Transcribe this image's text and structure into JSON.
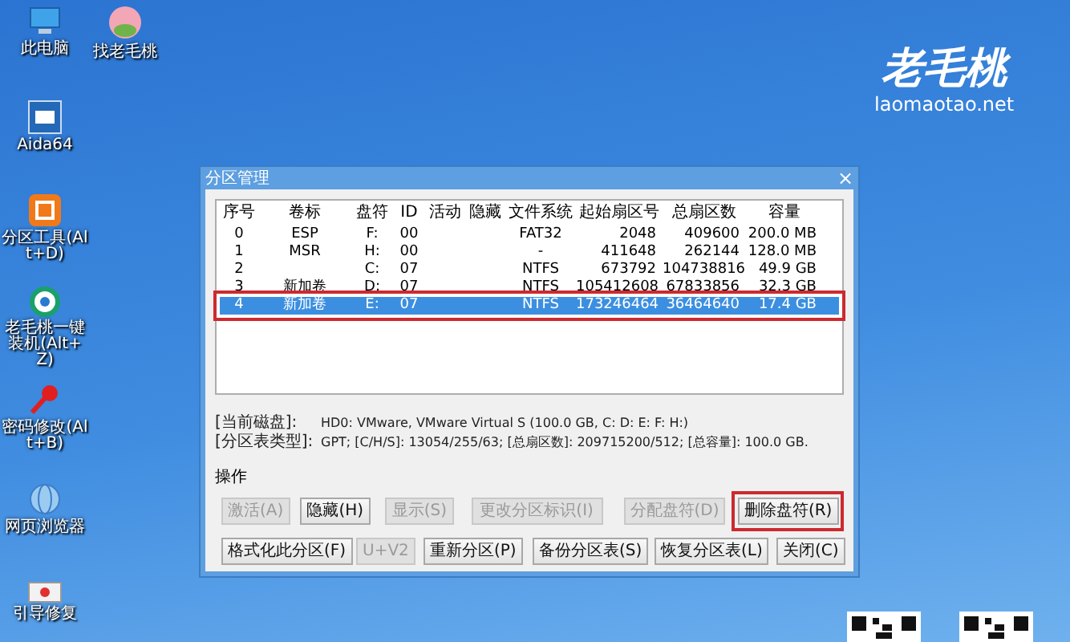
{
  "desktop_icons": [
    {
      "label": "此电脑"
    },
    {
      "label": "找老毛桃"
    },
    {
      "label": "Aida64"
    },
    {
      "label": "分区工具(Alt+D)"
    },
    {
      "label": "老毛桃一键装机(Alt+Z)"
    },
    {
      "label": "密码修改(Alt+B)"
    },
    {
      "label": "网页浏览器"
    },
    {
      "label": "引导修复"
    }
  ],
  "logo": {
    "title": "老毛桃",
    "url": "laomaotao.net"
  },
  "dialog": {
    "title": "分区管理",
    "close": "×",
    "table": {
      "columns": [
        "序号",
        "卷标",
        "盘符",
        "ID",
        "活动",
        "隐藏",
        "文件系统",
        "起始扇区号",
        "总扇区数",
        "容量"
      ],
      "rows": [
        {
          "cells": [
            "0",
            "ESP",
            "F:",
            "00",
            "",
            "",
            "FAT32",
            "2048",
            "409600",
            "200.0 MB"
          ],
          "selected": false,
          "highlighted": false
        },
        {
          "cells": [
            "1",
            "MSR",
            "H:",
            "00",
            "",
            "",
            "-",
            "411648",
            "262144",
            "128.0 MB"
          ],
          "selected": false,
          "highlighted": false
        },
        {
          "cells": [
            "2",
            "",
            "C:",
            "07",
            "",
            "",
            "NTFS",
            "673792",
            "104738816",
            "49.9 GB"
          ],
          "selected": false,
          "highlighted": false
        },
        {
          "cells": [
            "3",
            "新加卷",
            "D:",
            "07",
            "",
            "",
            "NTFS",
            "105412608",
            "67833856",
            "32.3 GB"
          ],
          "selected": false,
          "highlighted": false
        },
        {
          "cells": [
            "4",
            "新加卷",
            "E:",
            "07",
            "",
            "",
            "NTFS",
            "173246464",
            "36464640",
            "17.4 GB"
          ],
          "selected": true,
          "highlighted": true
        }
      ]
    },
    "info": [
      {
        "label": "[当前磁盘]:",
        "value": "HD0: VMware, VMware Virtual S (100.0 GB, C: D: E: F: H:)"
      },
      {
        "label": "[分区表类型]:",
        "value": "GPT;      [C/H/S]: 13054/255/63; [总扇区数]: 209715200/512; [总容量]: 100.0 GB."
      }
    ],
    "operations_label": "操作",
    "button_rows": [
      [
        {
          "label": "激活(A)",
          "disabled": true
        },
        {
          "label": "隐藏(H)",
          "disabled": false
        },
        {
          "label": "显示(S)",
          "disabled": true
        },
        {
          "label": "更改分区标识(I)",
          "disabled": true
        },
        {
          "label": "分配盘符(D)",
          "disabled": true
        },
        {
          "label": "删除盘符(R)",
          "disabled": false,
          "highlighted": true
        }
      ],
      [
        {
          "label": "格式化此分区(F)",
          "disabled": false
        },
        {
          "label": "U+V2",
          "disabled": true
        },
        {
          "label": "重新分区(P)",
          "disabled": false
        },
        {
          "label": "备份分区表(S)",
          "disabled": false
        },
        {
          "label": "恢复分区表(L)",
          "disabled": false
        },
        {
          "label": "关闭(C)",
          "disabled": false
        }
      ]
    ]
  }
}
